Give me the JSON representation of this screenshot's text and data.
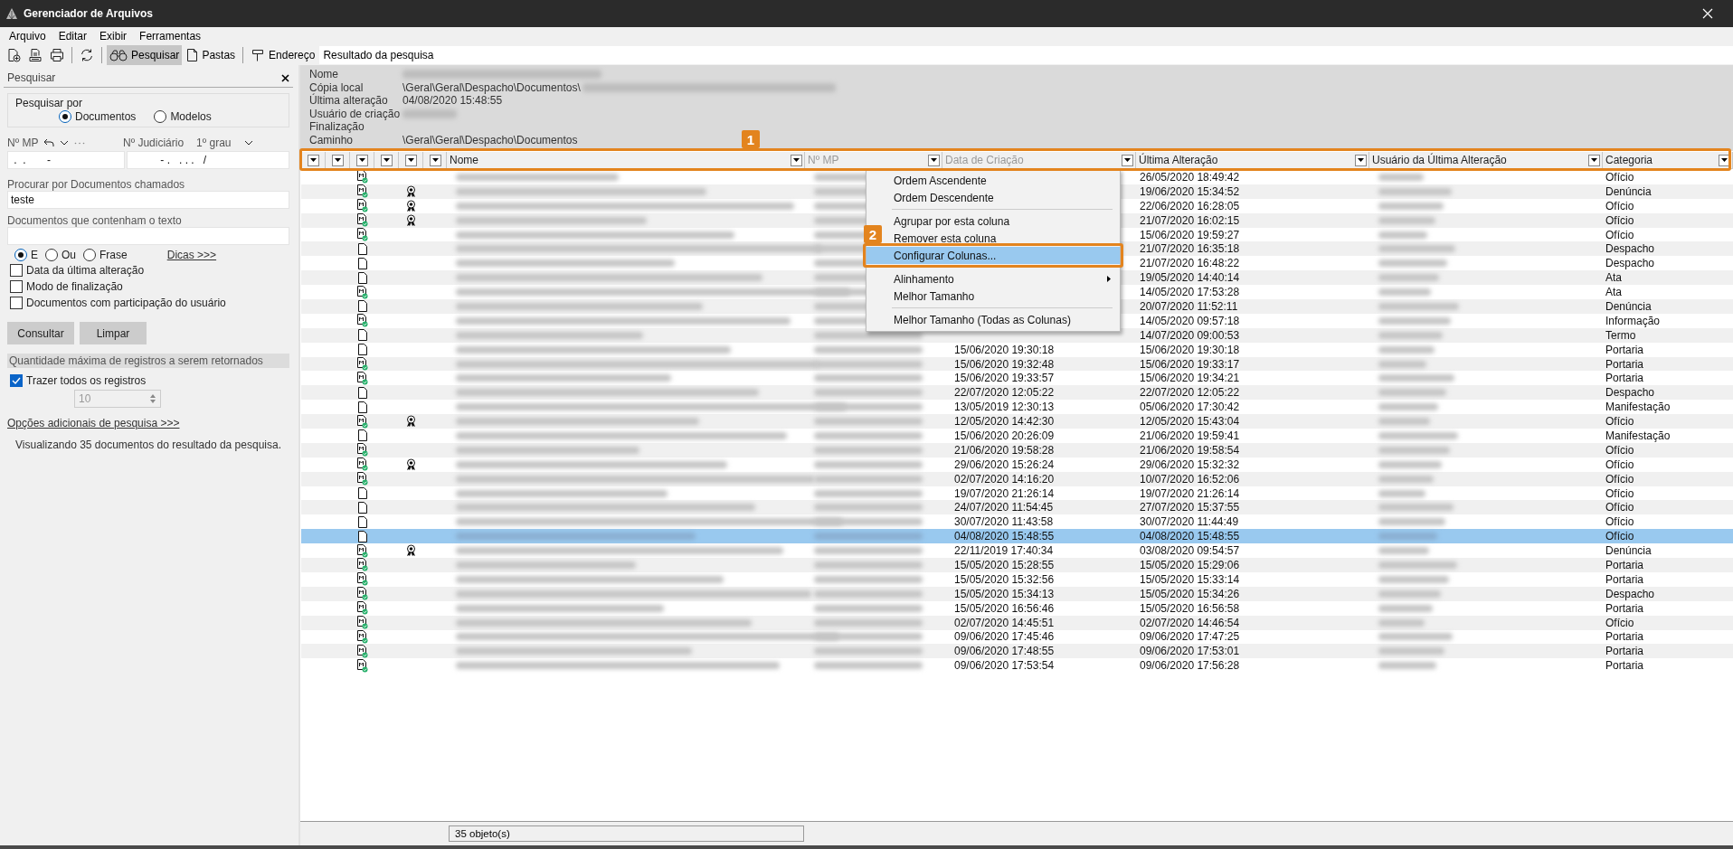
{
  "window": {
    "title": "Gerenciador de Arquivos"
  },
  "menu_bar": [
    "Arquivo",
    "Editar",
    "Exibir",
    "Ferramentas"
  ],
  "toolbar": [
    {
      "kind": "new-doc",
      "pressed": false
    },
    {
      "kind": "doc-stack",
      "pressed": false
    },
    {
      "kind": "print",
      "pressed": false
    },
    {
      "kind": "separator"
    },
    {
      "kind": "refresh",
      "pressed": false
    },
    {
      "kind": "separator"
    },
    {
      "kind": "binoculars",
      "label": "Pesquisar",
      "pressed": true
    },
    {
      "kind": "page",
      "label": "Pastas",
      "pressed": false
    },
    {
      "kind": "separator"
    },
    {
      "kind": "signpost",
      "label": "Endereço",
      "pressed": false
    }
  ],
  "address": {
    "value": "Resultado da pesquisa"
  },
  "search_panel": {
    "title": "Pesquisar",
    "search_by": {
      "label": "Pesquisar por",
      "options": [
        {
          "label": "Documentos",
          "selected": true
        },
        {
          "label": "Modelos",
          "selected": false
        }
      ]
    },
    "mp_number": {
      "label": "Nº MP",
      "value": " .  .       -"
    },
    "judicial_number": {
      "label": "Nº Judiciário",
      "instance": "1º grau",
      "value": "          - .   . . .   /"
    },
    "name_search": {
      "label": "Procurar por Documentos chamados",
      "value": "teste"
    },
    "text_search": {
      "label": "Documentos que contenham o texto"
    },
    "match_modes": [
      {
        "label": "E",
        "selected": true
      },
      {
        "label": "Ou",
        "selected": false
      },
      {
        "label": "Frase",
        "selected": false
      }
    ],
    "tips_link": "Dicas >>>",
    "filters": [
      {
        "label": "Data da última alteração",
        "checked": false
      },
      {
        "label": "Modo de finalização",
        "checked": false
      },
      {
        "label": "Documentos com participação do usuário",
        "checked": false
      }
    ],
    "buttons": [
      "Consultar",
      "Limpar"
    ],
    "limit_section": "Quantidade máxima de registros a serem retornados",
    "fetch_all": {
      "label": "Trazer todos os registros",
      "checked": true
    },
    "limit": {
      "value": "10",
      "disabled": true
    },
    "more_options_link": "Opções adicionais de pesquisa >>>",
    "summary": "Visualizando 35 documentos do resultado da pesquisa."
  },
  "details": [
    {
      "label": "Nome",
      "redacted": true
    },
    {
      "label": "Cópia local",
      "value": "\\Geral\\Geral\\Despacho\\Documentos\\",
      "redacted": true
    },
    {
      "label": "Última alteração",
      "value": "04/08/2020 15:48:55",
      "redacted": false
    },
    {
      "label": "Usuário de criação",
      "redacted": true
    },
    {
      "label": "Finalização",
      "redacted": false
    },
    {
      "label": "Caminho",
      "value": "\\Geral\\Geral\\Despacho\\Documentos",
      "redacted": false
    }
  ],
  "table": {
    "callout": "1",
    "columns": [
      {
        "label": "Nome",
        "dimmed": false
      },
      {
        "label": "Nº MP",
        "dimmed": true
      },
      {
        "label": "Data de Criação",
        "dimmed": true
      },
      {
        "label": "Última Alteração",
        "dimmed": false
      },
      {
        "label": "Usuário da Última Alteração",
        "dimmed": false
      },
      {
        "label": "Categoria",
        "dimmed": false
      }
    ],
    "rows": [
      {
        "kind": "signed",
        "sealed": false,
        "modified": "26/05/2020 18:49:42",
        "category": "Ofício",
        "selected": false
      },
      {
        "kind": "signed",
        "sealed": true,
        "modified": "19/06/2020 15:34:52",
        "category": "Denúncia",
        "selected": false
      },
      {
        "kind": "signed",
        "sealed": true,
        "modified": "22/06/2020 16:28:05",
        "category": "Ofício",
        "selected": false
      },
      {
        "kind": "signed",
        "sealed": true,
        "modified": "21/07/2020 16:02:15",
        "category": "Ofício",
        "selected": false
      },
      {
        "kind": "signed",
        "sealed": false,
        "modified": "15/06/2020 19:59:27",
        "category": "Ofício",
        "selected": false
      },
      {
        "kind": "plain",
        "sealed": false,
        "modified": "21/07/2020 16:35:18",
        "category": "Despacho",
        "selected": false
      },
      {
        "kind": "plain",
        "sealed": false,
        "modified": "21/07/2020 16:48:22",
        "category": "Despacho",
        "selected": false
      },
      {
        "kind": "plain",
        "sealed": false,
        "modified": "19/05/2020 14:40:14",
        "category": "Ata",
        "selected": false
      },
      {
        "kind": "signed",
        "sealed": false,
        "modified": "14/05/2020 17:53:28",
        "category": "Ata",
        "selected": false
      },
      {
        "kind": "plain",
        "sealed": false,
        "modified": "20/07/2020 11:52:11",
        "category": "Denúncia",
        "selected": false
      },
      {
        "kind": "signed",
        "sealed": false,
        "modified": "14/05/2020 09:57:18",
        "category": "Informação",
        "selected": false
      },
      {
        "kind": "plain",
        "sealed": false,
        "modified": "14/07/2020 09:00:53",
        "category": "Termo",
        "selected": false
      },
      {
        "kind": "plain",
        "sealed": false,
        "created": "15/06/2020 19:30:18",
        "modified": "15/06/2020 19:30:18",
        "category": "Portaria",
        "selected": false
      },
      {
        "kind": "signed",
        "sealed": false,
        "created": "15/06/2020 19:32:48",
        "modified": "15/06/2020 19:33:17",
        "category": "Portaria",
        "selected": false
      },
      {
        "kind": "signed",
        "sealed": false,
        "created": "15/06/2020 19:33:57",
        "modified": "15/06/2020 19:34:21",
        "category": "Portaria",
        "selected": false
      },
      {
        "kind": "plain",
        "sealed": false,
        "created": "22/07/2020 12:05:22",
        "modified": "22/07/2020 12:05:22",
        "category": "Despacho",
        "selected": false
      },
      {
        "kind": "plain",
        "sealed": false,
        "created": "13/05/2019 12:30:13",
        "modified": "05/06/2020 17:30:42",
        "category": "Manifestação",
        "selected": false
      },
      {
        "kind": "signed",
        "sealed": true,
        "created": "12/05/2020 14:42:30",
        "modified": "12/05/2020 15:43:04",
        "category": "Ofício",
        "selected": false
      },
      {
        "kind": "plain",
        "sealed": false,
        "created": "15/06/2020 20:26:09",
        "modified": "21/06/2020 19:59:41",
        "category": "Manifestação",
        "selected": false
      },
      {
        "kind": "signed",
        "sealed": false,
        "created": "21/06/2020 19:58:28",
        "modified": "21/06/2020 19:58:54",
        "category": "Ofício",
        "selected": false
      },
      {
        "kind": "signed",
        "sealed": true,
        "created": "29/06/2020 15:26:24",
        "modified": "29/06/2020 15:32:32",
        "category": "Ofício",
        "selected": false
      },
      {
        "kind": "signed",
        "sealed": false,
        "created": "02/07/2020 14:16:20",
        "modified": "10/07/2020 16:52:06",
        "category": "Ofício",
        "selected": false
      },
      {
        "kind": "plain",
        "sealed": false,
        "created": "19/07/2020 21:26:14",
        "modified": "19/07/2020 21:26:14",
        "category": "Ofício",
        "selected": false
      },
      {
        "kind": "plain",
        "sealed": false,
        "created": "24/07/2020 11:54:45",
        "modified": "27/07/2020 15:37:55",
        "category": "Ofício",
        "selected": false
      },
      {
        "kind": "plain",
        "sealed": false,
        "created": "30/07/2020 11:43:58",
        "modified": "30/07/2020 11:44:49",
        "category": "Ofício",
        "selected": false
      },
      {
        "kind": "plain",
        "sealed": false,
        "created": "04/08/2020 15:48:55",
        "modified": "04/08/2020 15:48:55",
        "category": "Ofício",
        "selected": true
      },
      {
        "kind": "signed",
        "sealed": true,
        "created": "22/11/2019 17:40:34",
        "modified": "03/08/2020 09:54:57",
        "category": "Denúncia",
        "selected": false
      },
      {
        "kind": "signed",
        "sealed": false,
        "created": "15/05/2020 15:28:55",
        "modified": "15/05/2020 15:29:06",
        "category": "Portaria",
        "selected": false
      },
      {
        "kind": "signed",
        "sealed": false,
        "created": "15/05/2020 15:32:56",
        "modified": "15/05/2020 15:33:14",
        "category": "Portaria",
        "selected": false
      },
      {
        "kind": "signed",
        "sealed": false,
        "created": "15/05/2020 15:34:13",
        "modified": "15/05/2020 15:34:26",
        "category": "Despacho",
        "selected": false
      },
      {
        "kind": "signed",
        "sealed": false,
        "created": "15/05/2020 16:56:46",
        "modified": "15/05/2020 16:56:58",
        "category": "Portaria",
        "selected": false
      },
      {
        "kind": "signed",
        "sealed": false,
        "created": "02/07/2020 14:45:51",
        "modified": "02/07/2020 14:46:54",
        "category": "Ofício",
        "selected": false
      },
      {
        "kind": "signed",
        "sealed": false,
        "created": "09/06/2020 17:45:46",
        "modified": "09/06/2020 17:47:25",
        "category": "Portaria",
        "selected": false
      },
      {
        "kind": "signed",
        "sealed": false,
        "created": "09/06/2020 17:48:55",
        "modified": "09/06/2020 17:53:01",
        "category": "Portaria",
        "selected": false
      },
      {
        "kind": "signed",
        "sealed": false,
        "created": "09/06/2020 17:53:54",
        "modified": "09/06/2020 17:56:28",
        "category": "Portaria",
        "selected": false
      }
    ]
  },
  "context_menu": {
    "items": [
      {
        "kind": "item",
        "label": "Ordem Ascendente",
        "highlighted": false,
        "submenu": false
      },
      {
        "kind": "item",
        "label": "Ordem Descendente",
        "highlighted": false,
        "submenu": false
      },
      {
        "kind": "separator"
      },
      {
        "kind": "item",
        "label": "Agrupar por esta coluna",
        "highlighted": false,
        "submenu": false
      },
      {
        "kind": "item",
        "label": "Remover esta coluna",
        "highlighted": false,
        "submenu": false
      },
      {
        "kind": "item",
        "label": "Configurar Colunas...",
        "highlighted": true,
        "submenu": false,
        "callout": "2"
      },
      {
        "kind": "separator"
      },
      {
        "kind": "item",
        "label": "Alinhamento",
        "highlighted": false,
        "submenu": true
      },
      {
        "kind": "item",
        "label": "Melhor Tamanho",
        "highlighted": false,
        "submenu": false
      },
      {
        "kind": "separator"
      },
      {
        "kind": "item",
        "label": "Melhor Tamanho (Todas as Colunas)",
        "highlighted": false,
        "submenu": false
      }
    ]
  },
  "status_bar": {
    "count": "35 objeto(s)"
  }
}
